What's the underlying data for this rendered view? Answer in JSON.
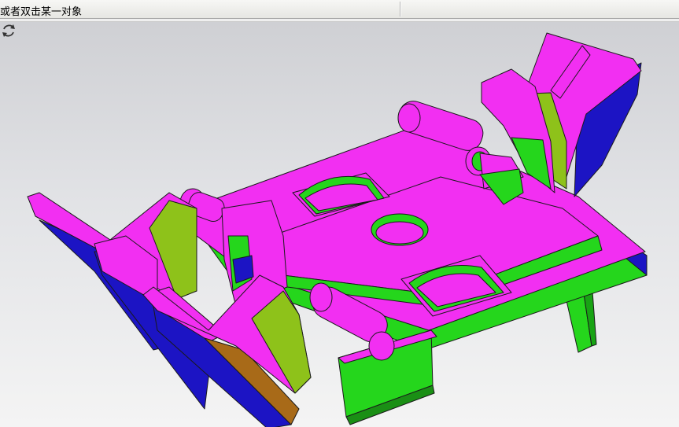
{
  "prompt_bar": {
    "text": "或者双击某一对象"
  },
  "viewport": {
    "model": "mold-part-3d",
    "colors": {
      "face_magenta": "#f22ff2",
      "face_green": "#25d61c",
      "face_blue": "#1c14c4",
      "face_olive": "#8ec21a",
      "face_brown": "#a86a18",
      "edge": "#1a1a1a"
    }
  },
  "icons": {
    "rotate": "rotate-view-icon"
  }
}
